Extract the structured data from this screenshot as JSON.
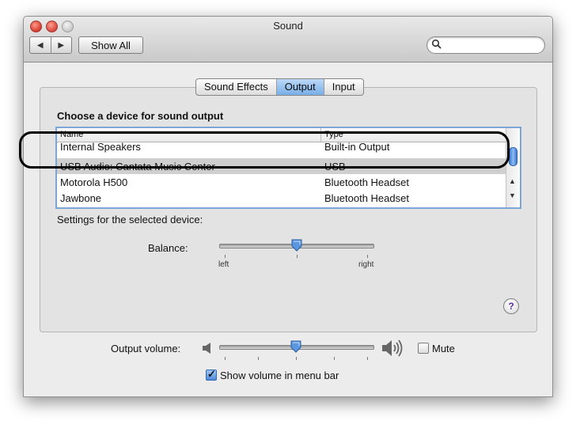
{
  "window": {
    "title": "Sound",
    "nav": {
      "back": "◀",
      "forward": "▶"
    },
    "show_all": "Show All",
    "search": {
      "value": "",
      "placeholder": ""
    }
  },
  "tabs": [
    {
      "label": "Sound Effects",
      "selected": false
    },
    {
      "label": "Output",
      "selected": true
    },
    {
      "label": "Input",
      "selected": false
    }
  ],
  "output": {
    "heading": "Choose a device for sound output",
    "columns": {
      "name": "Name",
      "type": "Type"
    },
    "devices": [
      {
        "name": "Internal Speakers",
        "type": "Built-in Output",
        "selected": false
      },
      {
        "name": "USB Audio: Cantata Music Center",
        "type": "USB",
        "selected": true
      },
      {
        "name": "Motorola H500",
        "type": "Bluetooth Headset",
        "selected": false
      },
      {
        "name": "Jawbone",
        "type": "Bluetooth Headset",
        "selected": false
      }
    ],
    "settings_label": "Settings for the selected device:",
    "balance": {
      "label": "Balance:",
      "left": "left",
      "right": "right",
      "value_fraction": 0.5
    },
    "help": "?"
  },
  "volume": {
    "label": "Output volume:",
    "value_fraction": 0.5,
    "mute_label": "Mute",
    "mute_checked": false,
    "show_in_menu_bar_label": "Show volume in menu bar",
    "show_in_menu_bar_checked": true
  },
  "colors": {
    "selection_blue": "#78aee8",
    "row_selected": "#cfcfcf",
    "table_border": "#7aa6d8"
  }
}
